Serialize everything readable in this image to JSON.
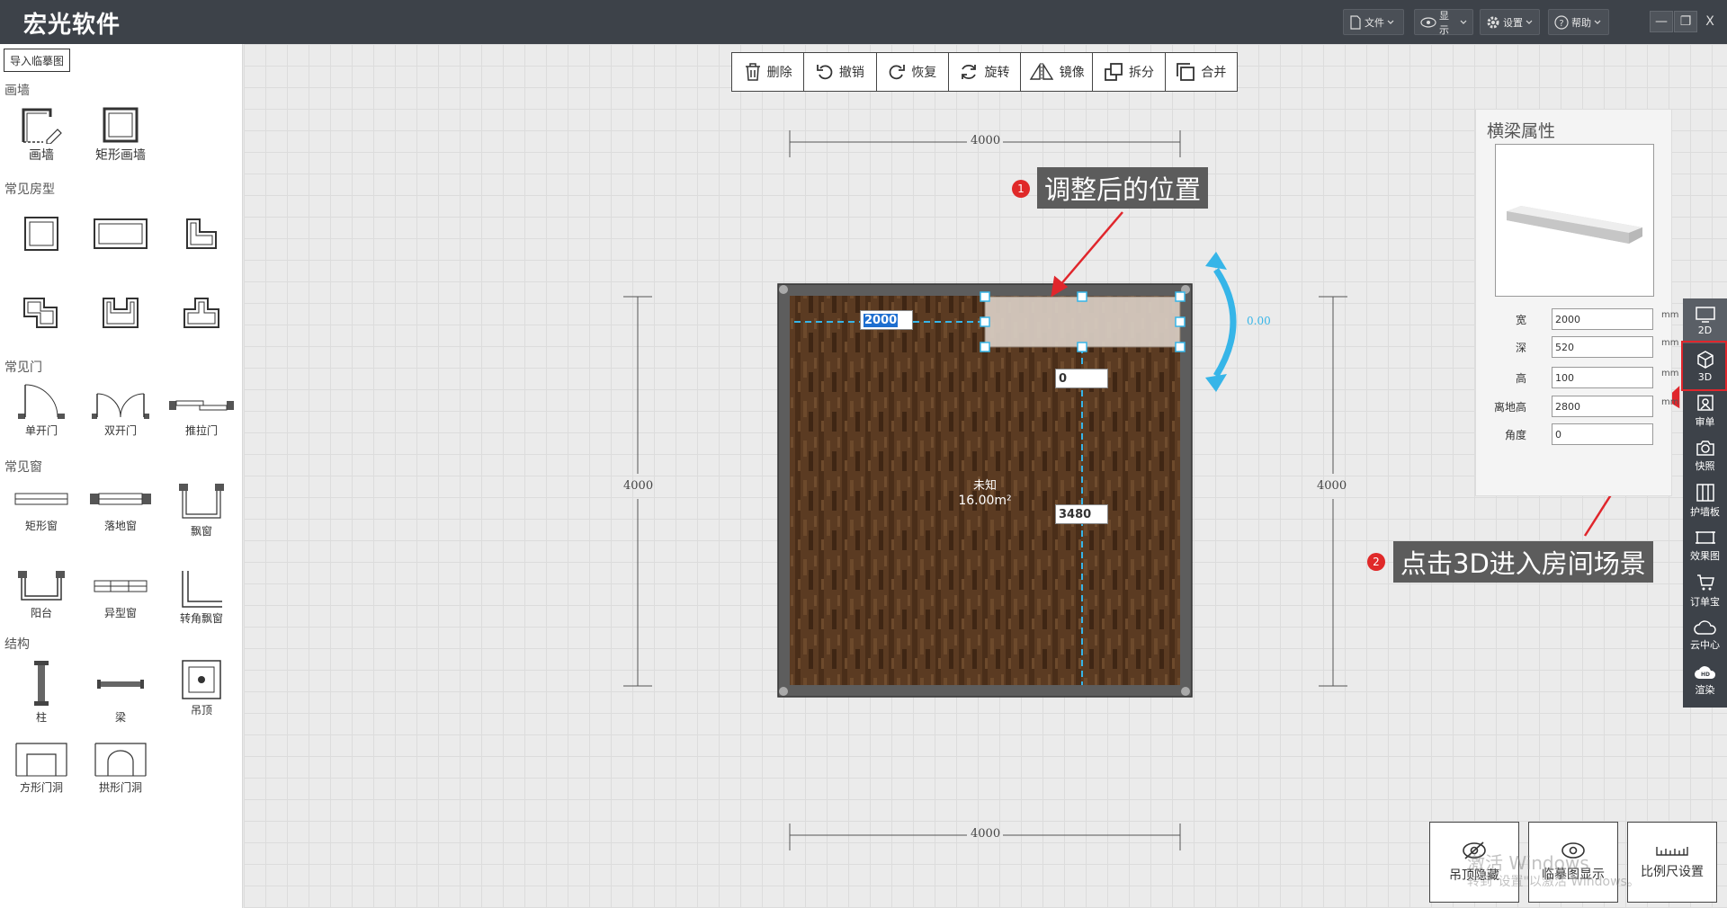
{
  "app": {
    "title": "宏光软件"
  },
  "menu": [
    {
      "id": "file",
      "label": "文件",
      "icon": "document-icon"
    },
    {
      "id": "display",
      "label": "显示",
      "icon": "eye-icon"
    },
    {
      "id": "settings",
      "label": "设置",
      "icon": "gear-icon"
    },
    {
      "id": "help",
      "label": "帮助",
      "icon": "help-icon"
    }
  ],
  "window": {
    "minimize": "—",
    "maximize": "❐",
    "close": "X"
  },
  "left": {
    "import_label": "导入临摹图",
    "categories": {
      "draw_wall": "画墙",
      "room_types": "常见房型",
      "doors": "常见门",
      "windows": "常见窗",
      "structure": "结构"
    },
    "items": {
      "draw_wall": "画墙",
      "rect_wall": "矩形画墙",
      "single_door": "单开门",
      "double_door": "双开门",
      "sliding_door": "推拉门",
      "rect_window": "矩形窗",
      "floor_window": "落地窗",
      "bay_window": "飘窗",
      "balcony": "阳台",
      "shaped_window": "异型窗",
      "corner_bay_window": "转角飘窗",
      "column": "柱",
      "beam": "梁",
      "ceiling": "吊顶",
      "square_doorway": "方形门洞",
      "arch_doorway": "拱形门洞"
    }
  },
  "toolbar": {
    "delete": "删除",
    "undo": "撤销",
    "redo": "恢复",
    "rotate": "旋转",
    "mirror": "镜像",
    "split": "拆分",
    "merge": "合并"
  },
  "plan": {
    "dim_top": "4000",
    "dim_bottom": "4000",
    "dim_left": "4000",
    "dim_right": "4000",
    "room_name": "未知",
    "room_area": "16.00m²",
    "beam_width_input": "2000",
    "beam_offset_input": "0",
    "beam_distance_input": "3480",
    "rotation_angle": "0.00"
  },
  "annotations": {
    "n1": "1",
    "c1": "调整后的位置",
    "n2": "2",
    "c2": "点击3D进入房间场景"
  },
  "props": {
    "title": "横梁属性",
    "rows": [
      {
        "label": "宽",
        "value": "2000",
        "unit": "mm"
      },
      {
        "label": "深",
        "value": "520",
        "unit": "mm"
      },
      {
        "label": "高",
        "value": "100",
        "unit": "mm"
      },
      {
        "label": "离地高",
        "value": "2800",
        "unit": "mm"
      },
      {
        "label": "角度",
        "value": "0",
        "unit": ""
      }
    ]
  },
  "rightbar": {
    "view_2d": "2D",
    "view_3d": "3D",
    "audit": "审单",
    "snapshot": "快照",
    "wall_panel": "护墙板",
    "render_image": "效果图",
    "order": "订单宝",
    "cloud": "云中心",
    "render": "渲染"
  },
  "bottom": {
    "ceiling_hide": "吊顶隐藏",
    "trace_show": "临摹图显示",
    "scale_settings": "比例尺设置"
  },
  "watermark": {
    "line1": "激活 Windows",
    "line2": "转到\"设置\"以激活 Windows。"
  },
  "colors": {
    "titlebar": "#3d4249",
    "accent_blue": "#36b5e8",
    "annotation_red": "#e0262c",
    "floor_wood": "#5a3a22"
  }
}
